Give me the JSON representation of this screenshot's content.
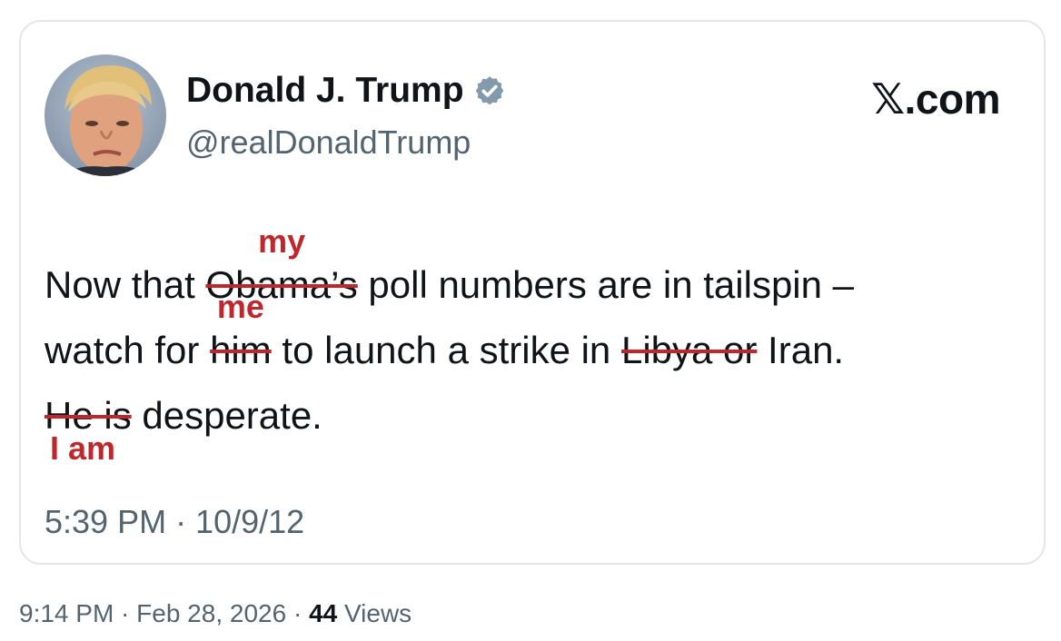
{
  "author": {
    "display_name": "Donald J. Trump",
    "handle": "@realDonaldTrump",
    "verified_icon": "verified-badge-icon",
    "avatar_icon": "profile-avatar"
  },
  "watermark": "𝕏.com",
  "tweet": {
    "line1": {
      "before": "Now that ",
      "struck": "Obama’s",
      "insert": "my",
      "after": " poll numbers are in tailspin –"
    },
    "line2": {
      "before": "watch for ",
      "struck1": "him",
      "insert1": "me",
      "middle": " to launch a strike in ",
      "struck2": "Libya or",
      "after": " Iran."
    },
    "line3": {
      "struck": "He is",
      "insert": "I am",
      "after": " desperate."
    },
    "timestamp": "5:39 PM · 10/9/12"
  },
  "footer": {
    "posted": "9:14 PM · Feb 28, 2026 · ",
    "views_count": "44",
    "views_label": " Views"
  },
  "colors": {
    "edit_red": "#c0272d",
    "secondary_text": "#536471",
    "card_border": "#e3e7ea"
  }
}
